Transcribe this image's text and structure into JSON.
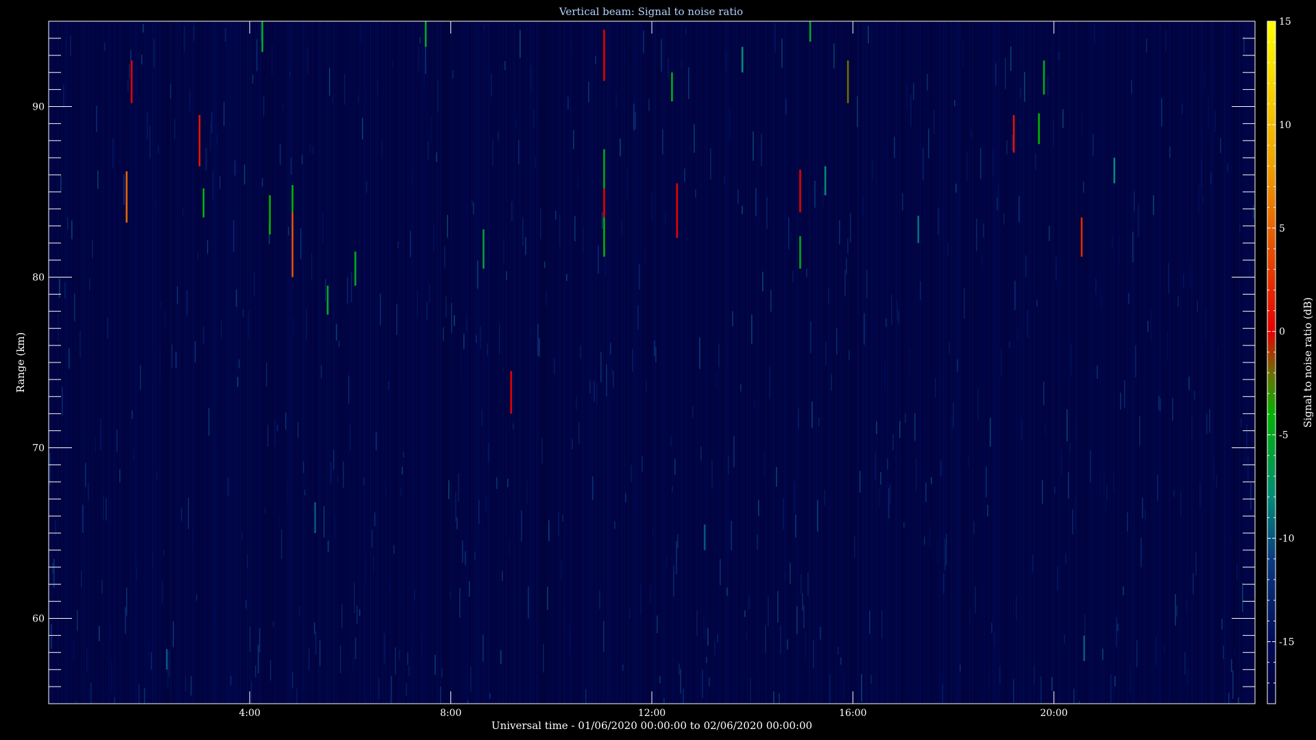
{
  "chart_data": {
    "type": "heatmap",
    "title": "Vertical beam: Signal to noise ratio",
    "xlabel": "Universal time - 01/06/2020 00:00:00 to 02/06/2020 00:00:00",
    "ylabel": "Range (km)",
    "xlim": [
      0,
      24
    ],
    "ylim": [
      55,
      95
    ],
    "x_ticks": [
      {
        "value": 4,
        "label": "4:00"
      },
      {
        "value": 8,
        "label": "8:00"
      },
      {
        "value": 12,
        "label": "12:00"
      },
      {
        "value": 16,
        "label": "16:00"
      },
      {
        "value": 20,
        "label": "20:00"
      }
    ],
    "y_ticks": [
      {
        "value": 60,
        "label": "60"
      },
      {
        "value": 70,
        "label": "70"
      },
      {
        "value": 80,
        "label": "80"
      },
      {
        "value": 90,
        "label": "90"
      }
    ],
    "colorbar": {
      "label": "Signal to noise ratio (dB)",
      "range": [
        -18,
        15
      ],
      "ticks": [
        {
          "value": 15,
          "label": "15"
        },
        {
          "value": 10,
          "label": "10"
        },
        {
          "value": 5,
          "label": "5"
        },
        {
          "value": 0,
          "label": "0"
        },
        {
          "value": -5,
          "label": "-5"
        },
        {
          "value": -10,
          "label": "-10"
        },
        {
          "value": -15,
          "label": "-15"
        }
      ],
      "stops": [
        {
          "value": -18,
          "color": "#000033"
        },
        {
          "value": -15,
          "color": "#000a5a"
        },
        {
          "value": -11,
          "color": "#0a3c82"
        },
        {
          "value": -8,
          "color": "#008c78"
        },
        {
          "value": -4,
          "color": "#00b400"
        },
        {
          "value": -2,
          "color": "#6e6e00"
        },
        {
          "value": 0,
          "color": "#e60000"
        },
        {
          "value": 4,
          "color": "#e65000"
        },
        {
          "value": 8,
          "color": "#f0a000"
        },
        {
          "value": 15,
          "color": "#ffff00"
        }
      ]
    },
    "background_snr_db": -17,
    "echoes": [
      {
        "time": 1.65,
        "range_start": 90.2,
        "range_end": 92.7,
        "snr_db": 0
      },
      {
        "time": 1.55,
        "range_start": 83.2,
        "range_end": 86.2,
        "snr_db": 5
      },
      {
        "time": 3.0,
        "range_start": 86.5,
        "range_end": 89.5,
        "snr_db": 1
      },
      {
        "time": 3.08,
        "range_start": 83.5,
        "range_end": 85.2,
        "snr_db": -4
      },
      {
        "time": 4.25,
        "range_start": 93.2,
        "range_end": 95.0,
        "snr_db": -5
      },
      {
        "time": 4.4,
        "range_start": 82.5,
        "range_end": 84.8,
        "snr_db": -4
      },
      {
        "time": 4.85,
        "range_start": 80.0,
        "range_end": 83.8,
        "snr_db": 4
      },
      {
        "time": 4.85,
        "range_start": 83.8,
        "range_end": 85.4,
        "snr_db": -4
      },
      {
        "time": 5.55,
        "range_start": 77.8,
        "range_end": 79.5,
        "snr_db": -5
      },
      {
        "time": 6.1,
        "range_start": 79.5,
        "range_end": 81.5,
        "snr_db": -5
      },
      {
        "time": 7.5,
        "range_start": 93.5,
        "range_end": 95.0,
        "snr_db": -5
      },
      {
        "time": 8.65,
        "range_start": 80.5,
        "range_end": 82.8,
        "snr_db": -6
      },
      {
        "time": 9.2,
        "range_start": 72.0,
        "range_end": 74.5,
        "snr_db": 0
      },
      {
        "time": 11.05,
        "range_start": 91.5,
        "range_end": 94.5,
        "snr_db": 0
      },
      {
        "time": 11.05,
        "range_start": 81.2,
        "range_end": 83.5,
        "snr_db": -4
      },
      {
        "time": 11.05,
        "range_start": 83.5,
        "range_end": 85.2,
        "snr_db": 0
      },
      {
        "time": 11.05,
        "range_start": 85.2,
        "range_end": 87.5,
        "snr_db": -5
      },
      {
        "time": 12.4,
        "range_start": 90.3,
        "range_end": 92.0,
        "snr_db": -5
      },
      {
        "time": 12.5,
        "range_start": 82.3,
        "range_end": 85.5,
        "snr_db": 0
      },
      {
        "time": 13.8,
        "range_start": 92.0,
        "range_end": 93.5,
        "snr_db": -8
      },
      {
        "time": 14.95,
        "range_start": 83.8,
        "range_end": 86.3,
        "snr_db": 0
      },
      {
        "time": 14.95,
        "range_start": 80.5,
        "range_end": 82.4,
        "snr_db": -5
      },
      {
        "time": 15.15,
        "range_start": 93.8,
        "range_end": 95.0,
        "snr_db": -5
      },
      {
        "time": 15.45,
        "range_start": 84.8,
        "range_end": 86.5,
        "snr_db": -8
      },
      {
        "time": 15.9,
        "range_start": 90.2,
        "range_end": 92.7,
        "snr_db": -2
      },
      {
        "time": 19.2,
        "range_start": 87.3,
        "range_end": 89.5,
        "snr_db": 1
      },
      {
        "time": 19.7,
        "range_start": 87.8,
        "range_end": 89.6,
        "snr_db": -4
      },
      {
        "time": 19.8,
        "range_start": 90.7,
        "range_end": 92.7,
        "snr_db": -5
      },
      {
        "time": 20.55,
        "range_start": 81.2,
        "range_end": 83.5,
        "snr_db": 2
      },
      {
        "time": 21.2,
        "range_start": 85.5,
        "range_end": 87.0,
        "snr_db": -8
      },
      {
        "time": 17.3,
        "range_start": 82.0,
        "range_end": 83.6,
        "snr_db": -9
      },
      {
        "time": 2.35,
        "range_start": 57.0,
        "range_end": 58.2,
        "snr_db": -10
      },
      {
        "time": 5.3,
        "range_start": 65.0,
        "range_end": 66.8,
        "snr_db": -10
      },
      {
        "time": 13.05,
        "range_start": 64.0,
        "range_end": 65.5,
        "snr_db": -10
      },
      {
        "time": 20.6,
        "range_start": 57.5,
        "range_end": 59.0,
        "snr_db": -10
      }
    ]
  }
}
